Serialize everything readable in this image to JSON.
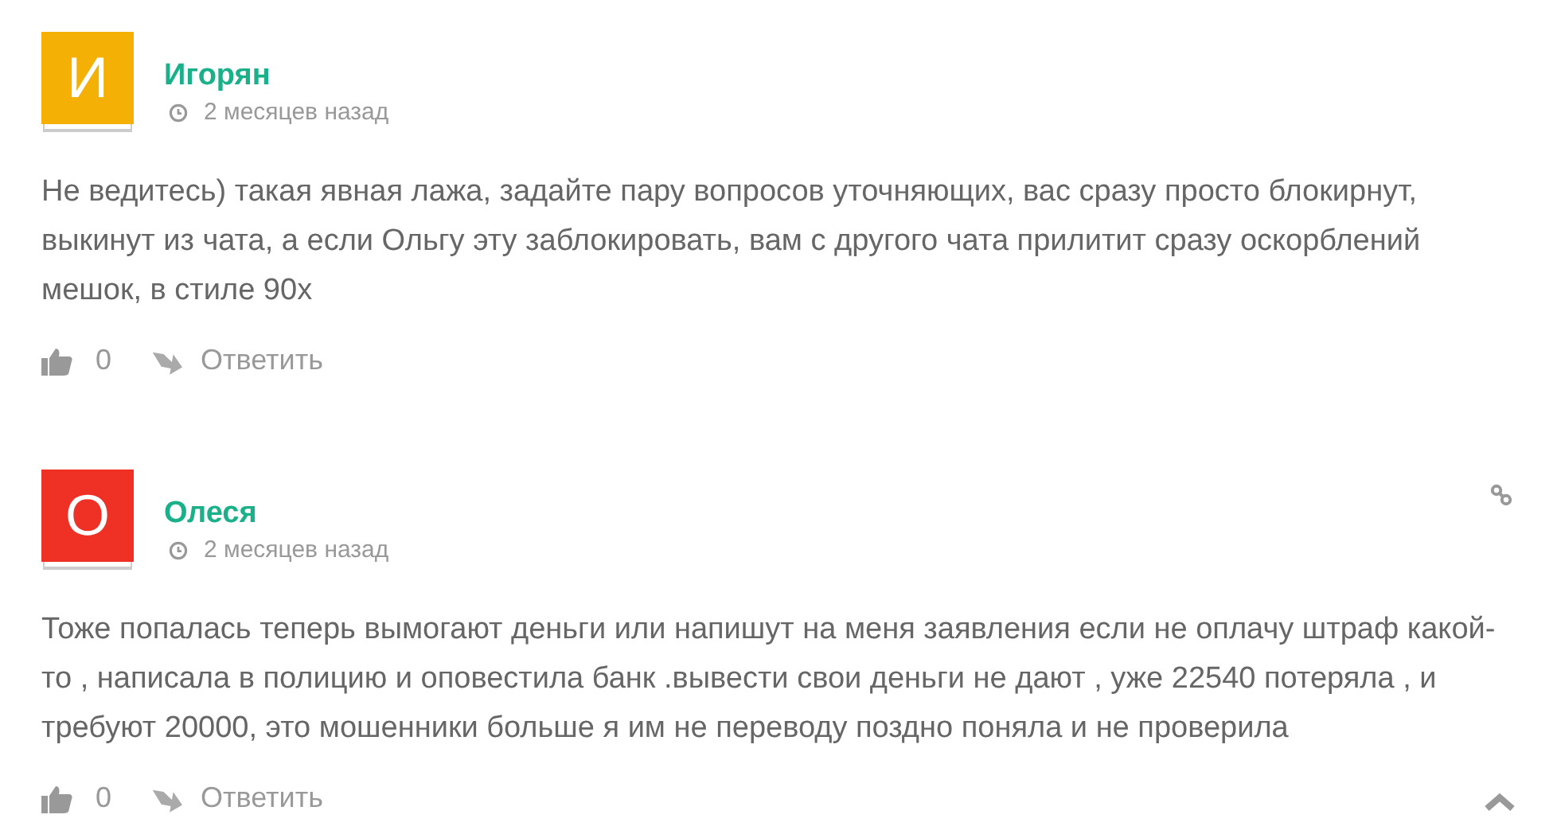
{
  "comments": [
    {
      "initial": "И",
      "color": "#f5b005",
      "author": "Игорян",
      "time": "2 месяцев назад",
      "text": "Не ведитесь) такая явная лажа, задайте пару вопросов уточняющих, вас сразу просто блокирнут, выкинут из чата, а если Ольгу эту заблокировать, вам с другого чата прилитит сразу оскорблений мешок, в стиле 90х",
      "likes": "0",
      "reply": "Ответить",
      "link": false
    },
    {
      "initial": "О",
      "color": "#ee3124",
      "author": "Олеся",
      "time": "2 месяцев назад",
      "text": "Тоже попалась теперь вымогают деньги или напишут на меня заявления если не оплачу штраф какой-то , написала в полицию и оповестила банк .вывести свои деньги не дают , уже 22540 потеряла , и требуют 20000, это мошенники больше я им не переводу поздно поняла и не проверила",
      "likes": "0",
      "reply": "Ответить",
      "link": true
    }
  ]
}
